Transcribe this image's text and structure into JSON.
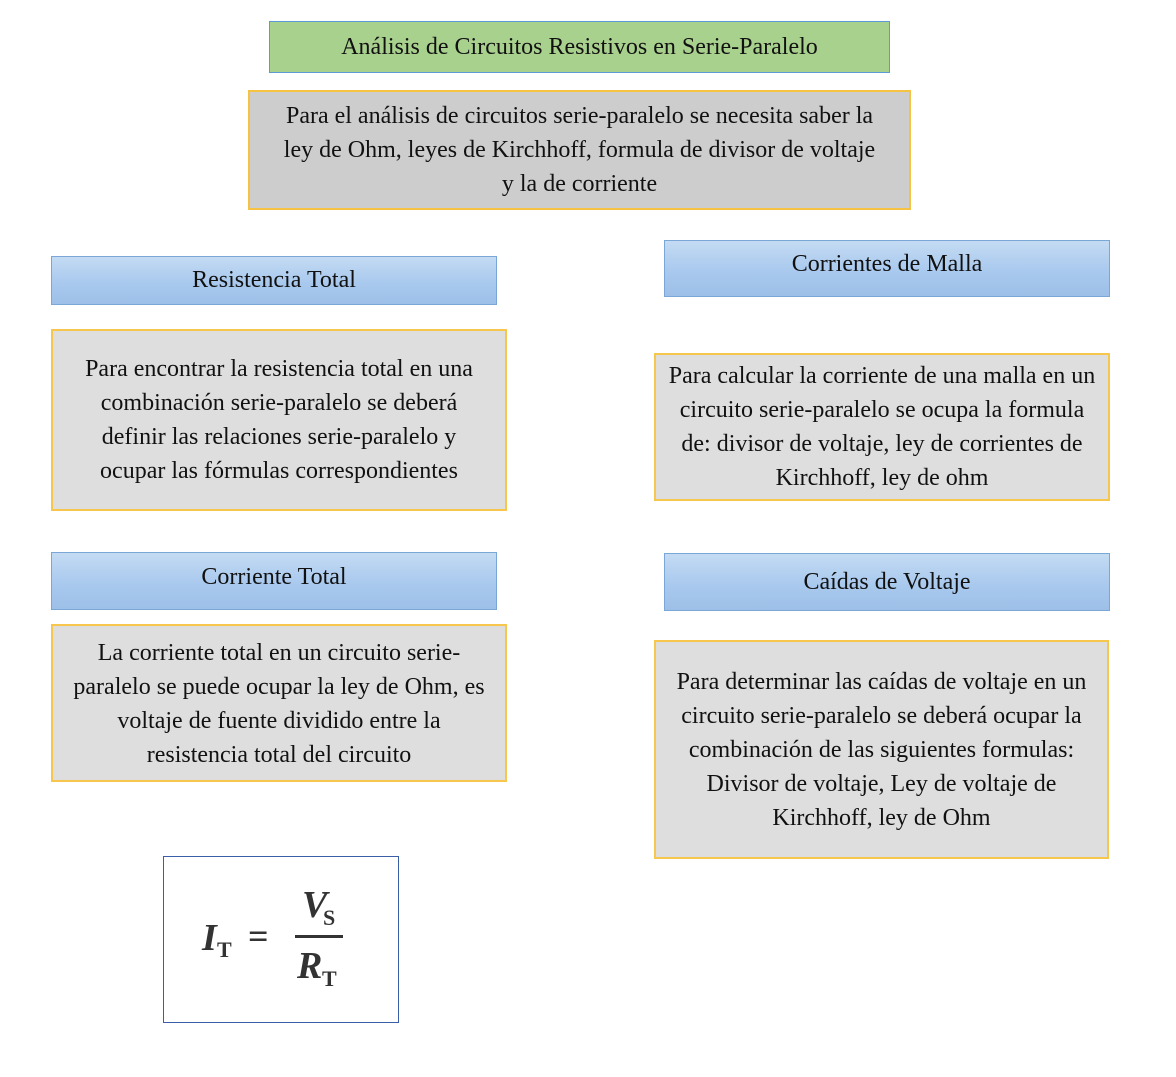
{
  "title": "Análisis de Circuitos Resistivos en Serie-Paralelo",
  "intro": "Para el análisis de circuitos serie-paralelo se necesita saber la ley de Ohm, leyes de Kirchhoff, formula de divisor de voltaje y la de corriente",
  "sections": {
    "resistencia_total": {
      "header": "Resistencia Total",
      "body": "Para encontrar la resistencia total en una combinación serie-paralelo se deberá definir las relaciones serie-paralelo y ocupar las fórmulas correspondientes"
    },
    "corriente_total": {
      "header": "Corriente Total",
      "body": "La corriente total en un circuito serie-paralelo se puede ocupar la ley de Ohm, es voltaje de fuente dividido entre la resistencia total del circuito"
    },
    "corrientes_malla": {
      "header": "Corrientes de Malla",
      "body": "Para calcular la corriente de una malla en un circuito serie-paralelo se ocupa la formula de: divisor de voltaje, ley de corrientes de Kirchhoff, ley de ohm"
    },
    "caidas_voltaje": {
      "header": "Caídas de Voltaje",
      "body": "Para determinar las caídas de voltaje en un circuito serie-paralelo se deberá ocupar la combinación de las siguientes formulas: Divisor de voltaje, Ley de voltaje de Kirchhoff, ley de Ohm"
    }
  },
  "formula": {
    "lhs": "I",
    "lhs_sub": "T",
    "equals": "=",
    "numerator": "V",
    "numerator_sub": "S",
    "denominator": "R",
    "denominator_sub": "T"
  }
}
